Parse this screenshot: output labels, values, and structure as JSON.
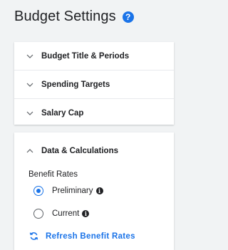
{
  "page": {
    "title": "Budget Settings",
    "help_icon_glyph": "?"
  },
  "accordion": {
    "collapsed_items": [
      {
        "label": "Budget Title & Periods",
        "icon": "chevron-down-icon"
      },
      {
        "label": "Spending Targets",
        "icon": "chevron-down-icon"
      },
      {
        "label": "Salary Cap",
        "icon": "chevron-down-icon"
      }
    ],
    "expanded_item": {
      "label": "Data & Calculations",
      "icon": "chevron-up-icon",
      "section_label": "Benefit Rates",
      "options": [
        {
          "label": "Preliminary",
          "selected": true,
          "info_glyph": "i"
        },
        {
          "label": "Current",
          "selected": false,
          "info_glyph": "i"
        }
      ],
      "action_label": "Refresh Benefit Rates"
    }
  },
  "colors": {
    "accent": "#1a73e8",
    "text": "#202124",
    "background": "#f1f3f4"
  }
}
